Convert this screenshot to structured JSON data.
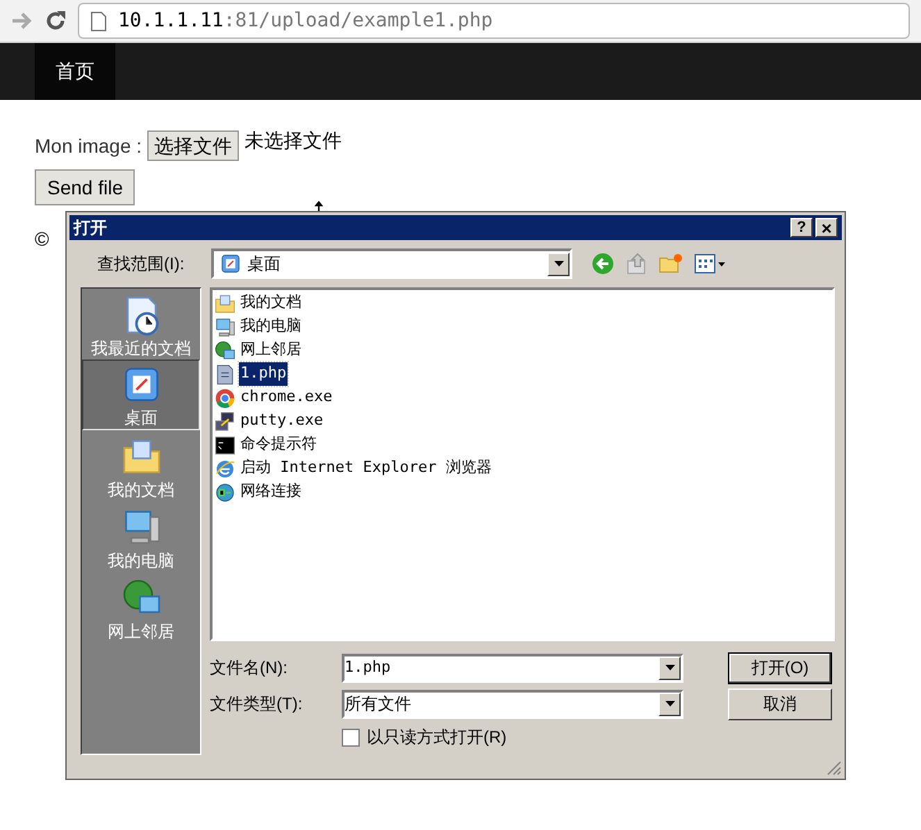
{
  "browser": {
    "url_host": "10.1.1.11",
    "url_rest": ":81/upload/example1.php"
  },
  "nav": {
    "items": [
      {
        "label": "首页",
        "selected": true
      }
    ]
  },
  "form": {
    "label": "Mon image :",
    "file_button": "选择文件",
    "file_status": "未选择文件",
    "submit": "Send file"
  },
  "footer_text": "©",
  "dialog": {
    "title": "打开",
    "help": "?",
    "close": "×",
    "look_in_label": "查找范围(I):",
    "look_in_value": "桌面",
    "places": [
      {
        "label": "我最近的文档",
        "kind": "recent",
        "selected": false
      },
      {
        "label": "桌面",
        "kind": "desktop",
        "selected": true
      },
      {
        "label": "我的文档",
        "kind": "documents",
        "selected": false
      },
      {
        "label": "我的电脑",
        "kind": "computer",
        "selected": false
      },
      {
        "label": "网上邻居",
        "kind": "network",
        "selected": false
      }
    ],
    "files": [
      {
        "name": "我的文档",
        "kind": "documents",
        "selected": false
      },
      {
        "name": "我的电脑",
        "kind": "computer",
        "selected": false
      },
      {
        "name": "网上邻居",
        "kind": "network",
        "selected": false
      },
      {
        "name": "1.php",
        "kind": "file",
        "selected": true
      },
      {
        "name": "chrome.exe",
        "kind": "chrome",
        "selected": false
      },
      {
        "name": "putty.exe",
        "kind": "putty",
        "selected": false
      },
      {
        "name": "命令提示符",
        "kind": "cmd",
        "selected": false
      },
      {
        "name": "启动 Internet Explorer 浏览器",
        "kind": "ie",
        "selected": false
      },
      {
        "name": "网络连接",
        "kind": "netconn",
        "selected": false
      }
    ],
    "filename_label": "文件名(N):",
    "filename_value": "1.php",
    "filetype_label": "文件类型(T):",
    "filetype_value": "所有文件",
    "readonly_label": "以只读方式打开(R)",
    "readonly_checked": false,
    "open_button": "打开(O)",
    "cancel_button": "取消"
  }
}
